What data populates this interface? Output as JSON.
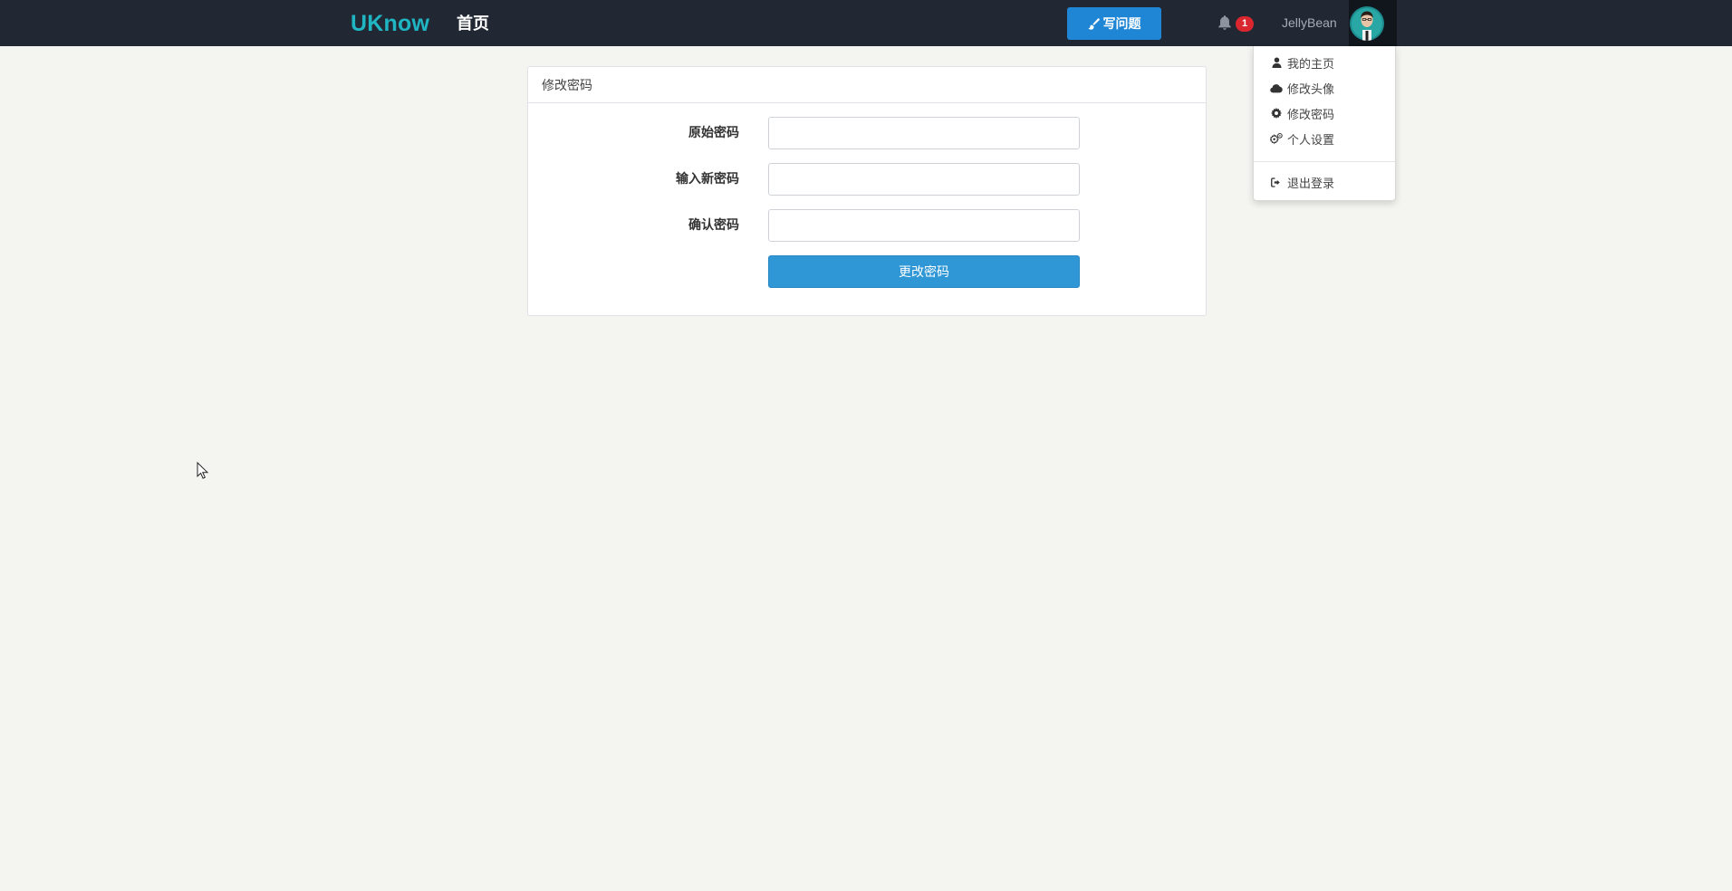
{
  "navbar": {
    "brand": "UKnow",
    "home_link": "首页",
    "ask_button_label": "写问题",
    "notification_count": "1",
    "username": "JellyBean"
  },
  "user_menu": {
    "items": [
      {
        "label": "我的主页",
        "icon": "user-icon"
      },
      {
        "label": "修改头像",
        "icon": "cloud-icon"
      },
      {
        "label": "修改密码",
        "icon": "gear-icon"
      },
      {
        "label": "个人设置",
        "icon": "gears-icon"
      }
    ],
    "logout_label": "退出登录",
    "logout_icon": "sign-out-icon"
  },
  "panel": {
    "title": "修改密码",
    "fields": [
      {
        "label": "原始密码",
        "value": "",
        "placeholder": ""
      },
      {
        "label": "输入新密码",
        "value": "",
        "placeholder": ""
      },
      {
        "label": "确认密码",
        "value": "",
        "placeholder": ""
      }
    ],
    "submit_label": "更改密码"
  },
  "colors": {
    "navbar_bg": "#212833",
    "brand": "#1fb5c3",
    "ask_button": "#1f86d5",
    "badge": "#d9262f",
    "submit_button": "#2f97d6",
    "page_bg": "#f4f4f0"
  }
}
